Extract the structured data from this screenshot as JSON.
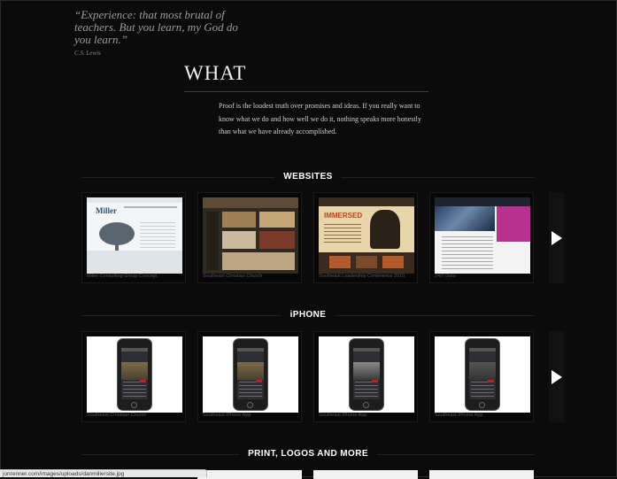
{
  "quote": {
    "text": "“Experience: that most brutal of teachers. But you learn, my God do you learn.”",
    "author": "C.S. Lewis"
  },
  "what": {
    "title": "WHAT",
    "intro": "Proof is the loudest truth over promises and ideas. If you really want to know what we do and how well we do it, nothing speaks more honestly than what we have already accomplished."
  },
  "sections": {
    "websites": {
      "label": "WEBSITES",
      "items": [
        {
          "caption": "Miller Consulting Group Concept"
        },
        {
          "caption": "Southeast Christian Church"
        },
        {
          "caption": "Southeast Leadership Conference 2010"
        },
        {
          "caption": "24/7 Data"
        }
      ]
    },
    "iphone": {
      "label": "iPHONE",
      "items": [
        {
          "caption": "Southeast Christian Church"
        },
        {
          "caption": "Southeast iPhone App"
        },
        {
          "caption": "Southeast iPhone App"
        },
        {
          "caption": "Southeast iPhone App"
        }
      ]
    },
    "print": {
      "label": "PRINT, LOGOS AND MORE"
    }
  },
  "status_bar": {
    "url": "jonrenner.com/images/uploads/danmillersite.jpg"
  },
  "icons": {
    "next": "arrow-right-icon"
  },
  "colors": {
    "background": "#0b0b0b",
    "heading": "#ffffff",
    "caption": "#555555"
  }
}
